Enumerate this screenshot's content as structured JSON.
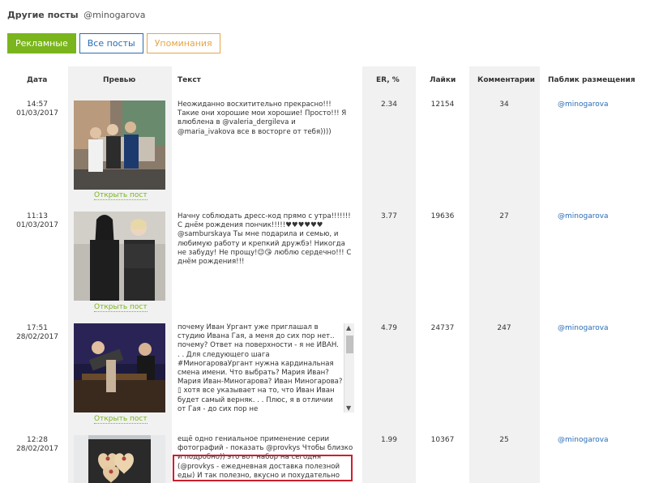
{
  "header": {
    "title": "Другие посты",
    "handle": "@minogarova"
  },
  "tabs": [
    {
      "label": "Рекламные"
    },
    {
      "label": "Все посты"
    },
    {
      "label": "Упоминания"
    }
  ],
  "columns": {
    "date": "Дата",
    "preview": "Превью",
    "text": "Текст",
    "er": "ER, %",
    "likes": "Лайки",
    "comments": "Комментарии",
    "placement": "Паблик размещения"
  },
  "open_post_label": "Открыть пост",
  "rows": [
    {
      "time": "14:57",
      "date": "01/03/2017",
      "text": "Неожиданно восхитительно прекрасно!!! Такие они хорошие мои хорошие! Просто!!! Я влюблена в @valeria_dergileva и @maria_ivakova все в восторге от тебя))))",
      "er": "2.34",
      "likes": "12154",
      "comments": "34",
      "placement": "@minogarova"
    },
    {
      "time": "11:13",
      "date": "01/03/2017",
      "text": "Начну соблюдать дресс-код прямо с утра!!!!!!! С днём рождения пончик!!!!!♥♥♥♥♥♥ @samburskaya Ты мне подарила и семью, и любимую работу и крепкий дружбэ! Никогда не забуду! Не прощу!😉😘 люблю сердечно!!! С днём рождения!!!",
      "er": "3.77",
      "likes": "19636",
      "comments": "27",
      "placement": "@minogarova"
    },
    {
      "time": "17:51",
      "date": "28/02/2017",
      "text": "почему Иван Ургант уже приглашал в студию Ивана Гая, а меня до сих пор нет.. почему? Ответ на поверхности - я не ИВАН. . . Для следующего шага #МиногароваУргант нужна кардинальная смена имени. Что выбрать? Мария Иван? Мария Иван-Миногарова? Иван Миногарова? ▯ хотя все указывает на то, что Иван Иван будет самый верняк. . . Плюс, я в отличии от Гая - до сих пор не",
      "er": "4.79",
      "likes": "24737",
      "comments": "247",
      "placement": "@minogarova"
    },
    {
      "time": "12:28",
      "date": "28/02/2017",
      "text": "ещё одно гениальное применение серии фотографий - показать @provkys Чтобы близко и подробно)) это вот набор на сегодня (@provkys - ежедневная доставка полезной еды) И так полезно, вкусно и похудательно",
      "er": "1.99",
      "likes": "10367",
      "comments": "25",
      "placement": "@minogarova"
    }
  ],
  "icons": {
    "scroll_up": "scroll-up-arrow-icon",
    "scroll_down": "scroll-down-arrow-icon"
  },
  "colors": {
    "accent_green": "#7ab51d",
    "link_blue": "#2a6db5",
    "mention_orange": "#e8a546",
    "highlight_red": "#cc1f2e"
  }
}
